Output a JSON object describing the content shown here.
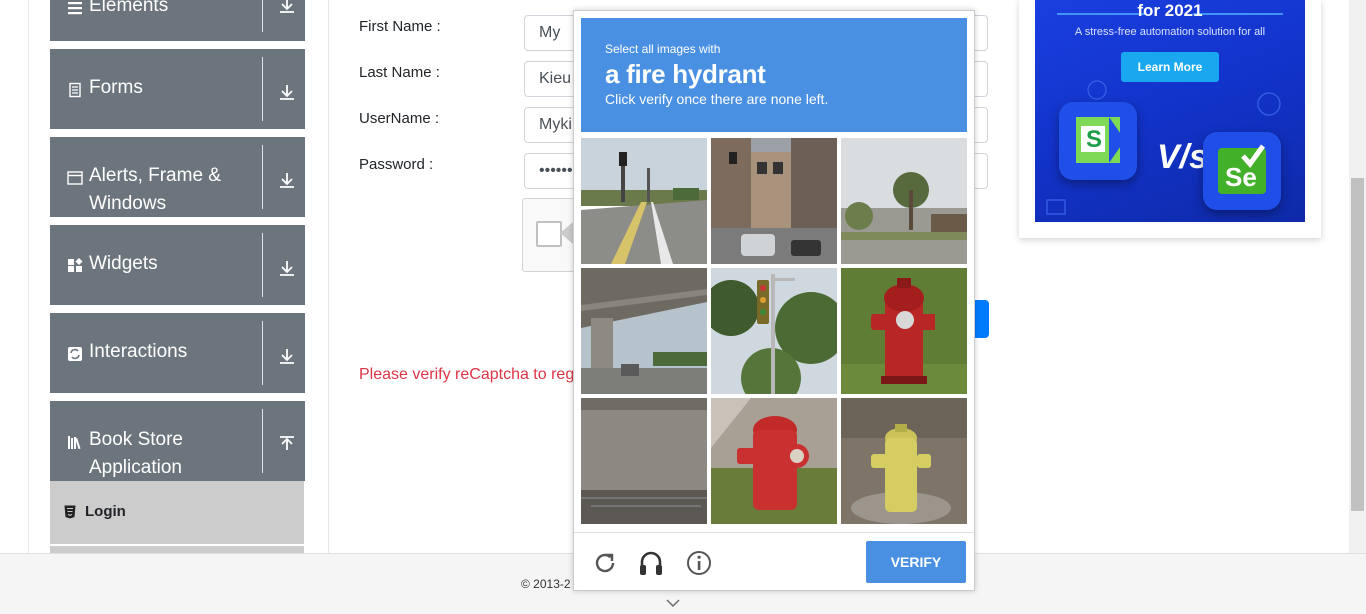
{
  "sidebar": {
    "groups": [
      {
        "title": "Elements",
        "icon": "menu-icon"
      },
      {
        "title": "Forms",
        "icon": "document-icon"
      },
      {
        "title": "Alerts, Frame &",
        "title2": "Windows",
        "icon": "window-icon"
      },
      {
        "title": "Widgets",
        "icon": "widgets-icon"
      },
      {
        "title": "Interactions",
        "icon": "interactions-icon"
      },
      {
        "title": "Book Store",
        "title2": "Application",
        "icon": "books-icon"
      }
    ],
    "active_item": {
      "label": "Login",
      "icon": "html-icon"
    }
  },
  "form": {
    "first_name_label": "First Name :",
    "first_name_value": "My",
    "last_name_label": "Last Name :",
    "last_name_value": "Kieu",
    "username_label": "UserName :",
    "username_value": "Myki",
    "password_label": "Password :",
    "password_value": "••••••"
  },
  "error_message": "Please verify reCaptcha to regi",
  "footer": {
    "copyright": "© 2013-2"
  },
  "ad": {
    "heading": "for 2021",
    "subtext": "A stress-free automation solution for all",
    "button": "Learn More",
    "vs": "V/s",
    "logo_left": "S",
    "logo_right": "Se"
  },
  "captcha": {
    "instruction_line1": "Select all images with",
    "target": "a fire hydrant",
    "instruction_line3": "Click verify once there are none left.",
    "verify_label": "VERIFY",
    "tools": [
      "reload-icon",
      "audio-icon",
      "info-icon"
    ],
    "colors": {
      "header": "#4a90e2",
      "button": "#4a90e2"
    }
  },
  "colors": {
    "sidebar_group": "#6c757d",
    "sidebar_active": "#cccccc",
    "error": "#dc3545",
    "primary": "#007bff"
  }
}
